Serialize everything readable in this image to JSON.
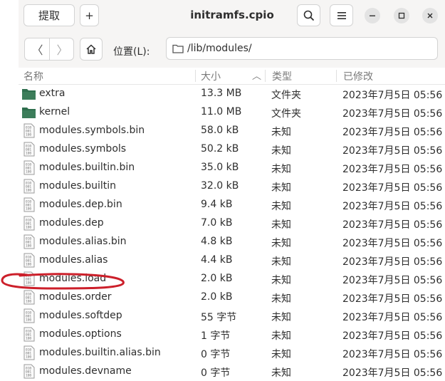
{
  "header": {
    "extract_label": "提取",
    "add_label": "+",
    "title": "initramfs.cpio",
    "search_glyph": "⚲",
    "menu_glyph": "☰",
    "minimize_glyph": "—",
    "maximize_glyph": "☐",
    "close_glyph": "✕"
  },
  "location": {
    "back_glyph": "〈",
    "forward_glyph": "〉",
    "label": "位置(L):",
    "path": "/lib/modules/"
  },
  "columns": {
    "name": "名称",
    "size": "大小",
    "sort_glyph": "︿",
    "type": "类型",
    "modified": "已修改"
  },
  "files": [
    {
      "name": "extra",
      "size": "13.3 MB",
      "type": "文件夹",
      "modified": "2023年7月5日 05:56",
      "icon": "folder-icon"
    },
    {
      "name": "kernel",
      "size": "11.0 MB",
      "type": "文件夹",
      "modified": "2023年7月5日 05:56",
      "icon": "folder-icon"
    },
    {
      "name": "modules.symbols.bin",
      "size": "58.0 kB",
      "type": "未知",
      "modified": "2023年7月5日 05:56",
      "icon": "binary-file-icon"
    },
    {
      "name": "modules.symbols",
      "size": "50.2 kB",
      "type": "未知",
      "modified": "2023年7月5日 05:56",
      "icon": "binary-file-icon"
    },
    {
      "name": "modules.builtin.bin",
      "size": "35.0 kB",
      "type": "未知",
      "modified": "2023年7月5日 05:56",
      "icon": "binary-file-icon"
    },
    {
      "name": "modules.builtin",
      "size": "32.0 kB",
      "type": "未知",
      "modified": "2023年7月5日 05:56",
      "icon": "binary-file-icon"
    },
    {
      "name": "modules.dep.bin",
      "size": "9.4 kB",
      "type": "未知",
      "modified": "2023年7月5日 05:56",
      "icon": "binary-file-icon"
    },
    {
      "name": "modules.dep",
      "size": "7.0 kB",
      "type": "未知",
      "modified": "2023年7月5日 05:56",
      "icon": "binary-file-icon"
    },
    {
      "name": "modules.alias.bin",
      "size": "4.8 kB",
      "type": "未知",
      "modified": "2023年7月5日 05:56",
      "icon": "binary-file-icon"
    },
    {
      "name": "modules.alias",
      "size": "4.4 kB",
      "type": "未知",
      "modified": "2023年7月5日 05:56",
      "icon": "binary-file-icon"
    },
    {
      "name": "modules.load",
      "size": "2.0 kB",
      "type": "未知",
      "modified": "2023年7月5日 05:56",
      "icon": "binary-file-icon"
    },
    {
      "name": "modules.order",
      "size": "2.0 kB",
      "type": "未知",
      "modified": "2023年7月5日 05:56",
      "icon": "binary-file-icon"
    },
    {
      "name": "modules.softdep",
      "size": "55 字节",
      "type": "未知",
      "modified": "2023年7月5日 05:56",
      "icon": "binary-file-icon"
    },
    {
      "name": "modules.options",
      "size": "1 字节",
      "type": "未知",
      "modified": "2023年7月5日 05:56",
      "icon": "binary-file-icon"
    },
    {
      "name": "modules.builtin.alias.bin",
      "size": "0 字节",
      "type": "未知",
      "modified": "2023年7月5日 05:56",
      "icon": "binary-file-icon"
    },
    {
      "name": "modules.devname",
      "size": "0 字节",
      "type": "未知",
      "modified": "2023年7月5日 05:56",
      "icon": "binary-file-icon"
    }
  ],
  "colors": {
    "folder": "#2f6f4e",
    "annotation": "#cc1f2a",
    "header_bg": "#f6f5f4"
  }
}
